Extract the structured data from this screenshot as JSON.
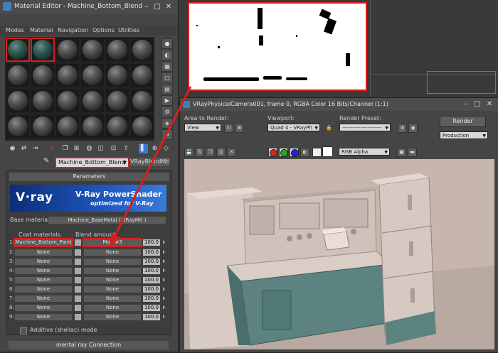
{
  "material_editor": {
    "title": "Material Editor - Machine_Bottom_Blend",
    "menu": [
      "Modes",
      "Material",
      "Navigation",
      "Options",
      "Utilities"
    ],
    "material_name": "Machine_Bottom_Blend",
    "material_type": "VRayBlendMtl",
    "rollout_title": "Parameters",
    "banner": {
      "logo": "V·ray",
      "title": "V-Ray PowerShader",
      "subtitle": "optimized for V-Ray"
    },
    "base_material_label": "Base material:",
    "base_material_value": "Machine_BaseMetal  ( VRayMtl )",
    "coat_materials_label": "Coat materials:",
    "blend_amount_label": "Blend amount:",
    "coat_rows": [
      {
        "num": "1:",
        "coat": "Machine_Bottom_Paint",
        "blend": "Map #3",
        "amount": "100.0"
      },
      {
        "num": "2:",
        "coat": "None",
        "blend": "None",
        "amount": "100.0"
      },
      {
        "num": "3:",
        "coat": "None",
        "blend": "None",
        "amount": "100.0"
      },
      {
        "num": "4:",
        "coat": "None",
        "blend": "None",
        "amount": "100.0"
      },
      {
        "num": "5:",
        "coat": "None",
        "blend": "None",
        "amount": "100.0"
      },
      {
        "num": "6:",
        "coat": "None",
        "blend": "None",
        "amount": "100.0"
      },
      {
        "num": "7:",
        "coat": "None",
        "blend": "None",
        "amount": "100.0"
      },
      {
        "num": "8:",
        "coat": "None",
        "blend": "None",
        "amount": "100.0"
      },
      {
        "num": "9:",
        "coat": "None",
        "blend": "None",
        "amount": "100.0"
      }
    ],
    "additive_label": "Additive (shellac) mode",
    "mentalray_label": "mental ray Connection"
  },
  "render_window": {
    "title": "VRayPhysicalCamera001, frame 0, RGBA Color 16 Bits/Channel (1:1)",
    "area_to_render_label": "Area to Render:",
    "area_to_render_value": "View",
    "viewport_label": "Viewport:",
    "viewport_value": "Quad 4 - VRayPh",
    "render_preset_label": "Render Preset:",
    "render_preset_value": "----------------------",
    "render_button": "Render",
    "production_value": "Production",
    "channel_value": "RGB Alpha"
  },
  "colors": {
    "highlight": "#d42020",
    "vray_blue": "#1d57bd"
  }
}
